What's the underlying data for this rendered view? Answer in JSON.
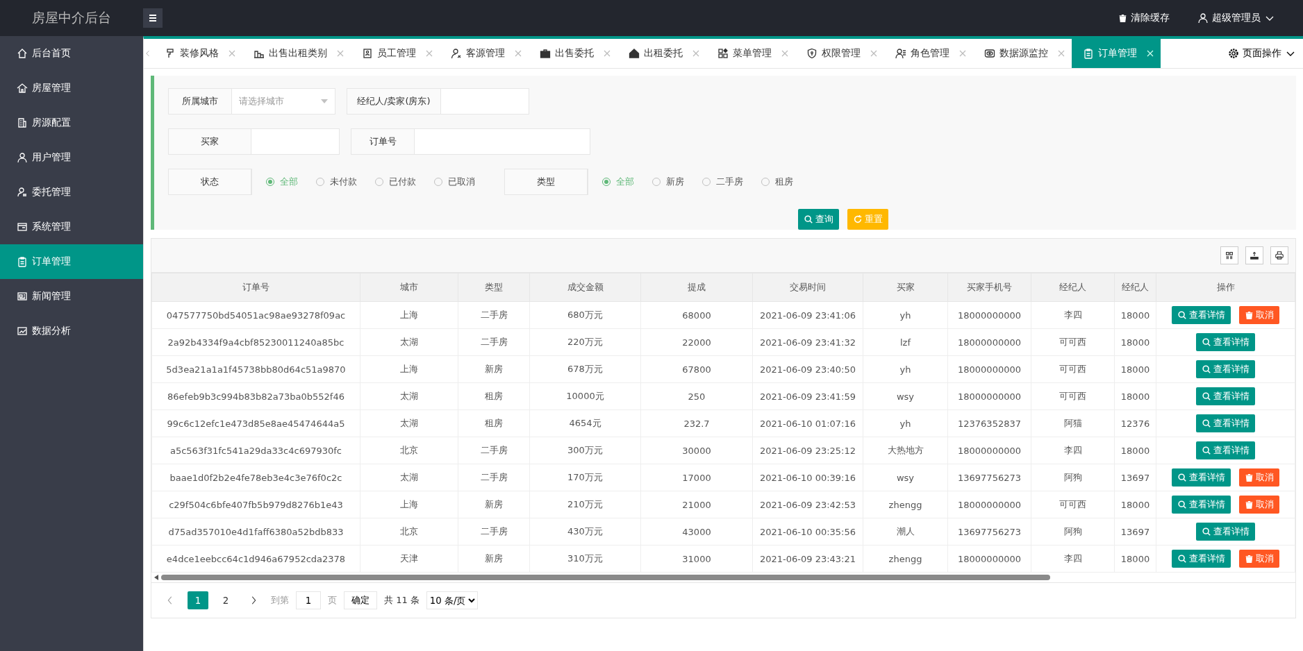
{
  "header": {
    "title": "房屋中介后台",
    "clear_cache": "清除缓存",
    "user": "超级管理员"
  },
  "sidebar": {
    "items": [
      {
        "label": "后台首页",
        "selected": false
      },
      {
        "label": "房屋管理",
        "selected": false
      },
      {
        "label": "房源配置",
        "selected": false
      },
      {
        "label": "用户管理",
        "selected": false
      },
      {
        "label": "委托管理",
        "selected": false
      },
      {
        "label": "系统管理",
        "selected": false
      },
      {
        "label": "订单管理",
        "selected": true
      },
      {
        "label": "新闻管理",
        "selected": false
      },
      {
        "label": "数据分析",
        "selected": false
      }
    ]
  },
  "tabs": [
    {
      "label": "装修风格",
      "selected": false
    },
    {
      "label": "出售出租类别",
      "selected": false
    },
    {
      "label": "员工管理",
      "selected": false
    },
    {
      "label": "客源管理",
      "selected": false
    },
    {
      "label": "出售委托",
      "selected": false
    },
    {
      "label": "出租委托",
      "selected": false
    },
    {
      "label": "菜单管理",
      "selected": false
    },
    {
      "label": "权限管理",
      "selected": false
    },
    {
      "label": "角色管理",
      "selected": false
    },
    {
      "label": "数据源监控",
      "selected": false
    },
    {
      "label": "订单管理",
      "selected": true
    }
  ],
  "page_actions": "页面操作",
  "filters": {
    "city": {
      "label": "所属城市",
      "placeholder": "请选择城市"
    },
    "agent_seller": {
      "label": "经纪人/卖家(房东)"
    },
    "buyer": {
      "label": "买家"
    },
    "order_no": {
      "label": "订单号"
    },
    "status": {
      "label": "状态",
      "options": [
        {
          "label": "全部",
          "selected": true
        },
        {
          "label": "未付款",
          "selected": false
        },
        {
          "label": "已付款",
          "selected": false
        },
        {
          "label": "已取消",
          "selected": false
        }
      ]
    },
    "type": {
      "label": "类型",
      "options": [
        {
          "label": "全部",
          "selected": true
        },
        {
          "label": "新房",
          "selected": false
        },
        {
          "label": "二手房",
          "selected": false
        },
        {
          "label": "租房",
          "selected": false
        }
      ]
    },
    "search_button": "查询",
    "reset_button": "重置"
  },
  "table": {
    "columns": [
      "订单号",
      "城市",
      "类型",
      "成交金额",
      "提成",
      "交易时间",
      "买家",
      "买家手机号",
      "经纪人",
      "经纪人",
      "操作"
    ],
    "rows": [
      {
        "cells": [
          "047577750bd54051ac98ae93278f09ac",
          "上海",
          "二手房",
          "680万元",
          "68000",
          "2021-06-09 23:41:06",
          "yh",
          "18000000000",
          "李四",
          "18000"
        ],
        "actions": [
          "查看详情",
          "取消"
        ]
      },
      {
        "cells": [
          "2a92b4334f9a4cbf85230011240a85bc",
          "太湖",
          "二手房",
          "220万元",
          "22000",
          "2021-06-09 23:41:32",
          "lzf",
          "18000000000",
          "可可西",
          "18000"
        ],
        "actions": [
          "查看详情"
        ]
      },
      {
        "cells": [
          "5d3ea21a1a1f45738bb80d64c51a9870",
          "上海",
          "新房",
          "678万元",
          "67800",
          "2021-06-09 23:40:50",
          "yh",
          "18000000000",
          "可可西",
          "18000"
        ],
        "actions": [
          "查看详情"
        ]
      },
      {
        "cells": [
          "86efeb9b3c994b83b82a73ba0b552f46",
          "太湖",
          "租房",
          "10000元",
          "250",
          "2021-06-09 23:41:59",
          "wsy",
          "18000000000",
          "可可西",
          "18000"
        ],
        "actions": [
          "查看详情"
        ]
      },
      {
        "cells": [
          "99c6c12efc1e473d85e8ae45474644a5",
          "太湖",
          "租房",
          "4654元",
          "232.7",
          "2021-06-10 01:07:16",
          "yh",
          "12376352837",
          "阿猫",
          "12376"
        ],
        "actions": [
          "查看详情"
        ]
      },
      {
        "cells": [
          "a5c563f31fc541a29da33c4c697930fc",
          "北京",
          "二手房",
          "300万元",
          "30000",
          "2021-06-09 23:25:12",
          "大热地方",
          "18000000000",
          "李四",
          "18000"
        ],
        "actions": [
          "查看详情"
        ]
      },
      {
        "cells": [
          "baae1d0f2b2e4fe78eb3e4c3e76f0c2c",
          "太湖",
          "二手房",
          "170万元",
          "17000",
          "2021-06-10 00:39:16",
          "wsy",
          "13697756273",
          "阿狗",
          "13697"
        ],
        "actions": [
          "查看详情",
          "取消"
        ]
      },
      {
        "cells": [
          "c29f504c6bfe407fb5b979d8276b1e43",
          "上海",
          "新房",
          "210万元",
          "21000",
          "2021-06-09 23:42:53",
          "zhengg",
          "18000000000",
          "可可西",
          "18000"
        ],
        "actions": [
          "查看详情",
          "取消"
        ]
      },
      {
        "cells": [
          "d75ad357010e4d1faff6380a52bdb833",
          "北京",
          "二手房",
          "430万元",
          "43000",
          "2021-06-10 00:35:56",
          "潮人",
          "13697756273",
          "阿狗",
          "13697"
        ],
        "actions": [
          "查看详情"
        ]
      },
      {
        "cells": [
          "e4dce1eebcc64c1d946a67952cda2378",
          "天津",
          "新房",
          "310万元",
          "31000",
          "2021-06-09 23:43:21",
          "zhengg",
          "18000000000",
          "李四",
          "18000"
        ],
        "actions": [
          "查看详情",
          "取消"
        ]
      }
    ]
  },
  "pagination": {
    "pages": [
      {
        "label": "1",
        "selected": true
      },
      {
        "label": "2",
        "selected": false
      }
    ],
    "goto_label": "到第",
    "goto_value": "1",
    "page_unit": "页",
    "confirm": "确定",
    "total": "共 11 条",
    "page_size": "10 条/页"
  }
}
